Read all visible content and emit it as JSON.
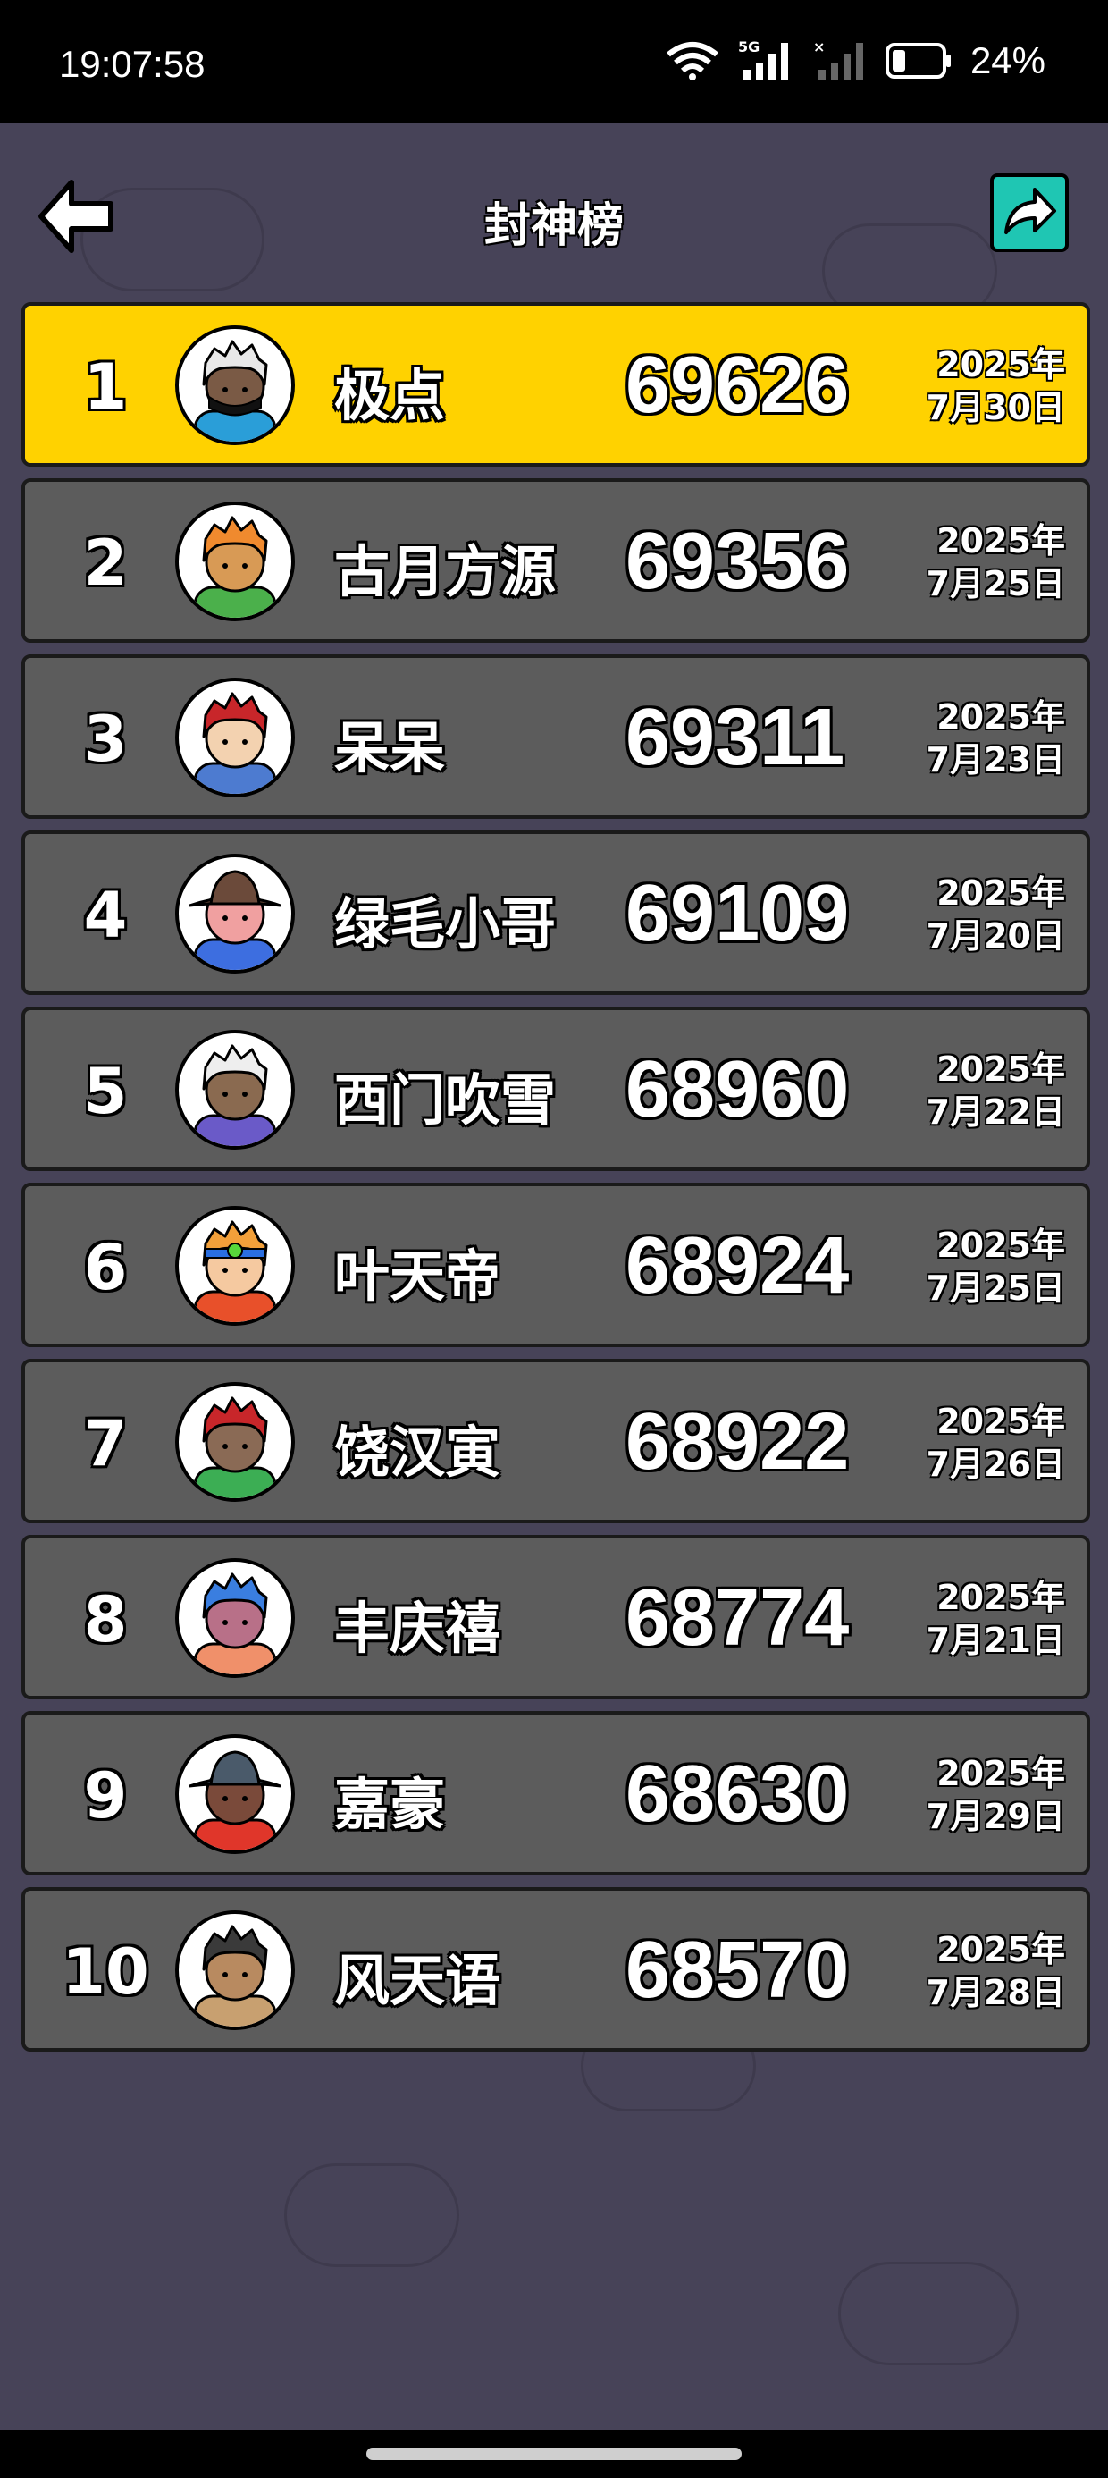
{
  "status_bar": {
    "time": "19:07:58",
    "network_label": "5G",
    "battery": "24%"
  },
  "header": {
    "title": "封神榜",
    "back_icon": "arrow-left-icon",
    "share_icon": "share-icon"
  },
  "colors": {
    "background": "#474358",
    "first_row": "#ffd200",
    "row": "#5c5c5c",
    "share_button": "#1fc6b3"
  },
  "leaderboard": [
    {
      "rank": "1",
      "name": "极点",
      "score": "69626",
      "date_year": "2025年",
      "date_day": "7月30日",
      "avatar": {
        "hair": "#e8e8e8",
        "skin": "#7a5a45",
        "shirt": "#2a9ed8",
        "mask": true
      }
    },
    {
      "rank": "2",
      "name": "古月方源",
      "score": "69356",
      "date_year": "2025年",
      "date_day": "7月25日",
      "avatar": {
        "hair": "#f08a2e",
        "skin": "#d89a55",
        "shirt": "#4bb04b"
      }
    },
    {
      "rank": "3",
      "name": "呆呆",
      "score": "69311",
      "date_year": "2025年",
      "date_day": "7月23日",
      "avatar": {
        "hair": "#c8262a",
        "skin": "#f3d2b0",
        "shirt": "#4d7bd0"
      }
    },
    {
      "rank": "4",
      "name": "绿毛小哥",
      "score": "69109",
      "date_year": "2025年",
      "date_day": "7月20日",
      "avatar": {
        "hair": "#6b4a3a",
        "skin": "#f0a0a0",
        "shirt": "#3d6ee0",
        "hat": true
      }
    },
    {
      "rank": "5",
      "name": "西门吹雪",
      "score": "68960",
      "date_year": "2025年",
      "date_day": "7月22日",
      "avatar": {
        "hair": "#eeeeee",
        "skin": "#8a6a50",
        "shirt": "#6a5ac8"
      }
    },
    {
      "rank": "6",
      "name": "叶天帝",
      "score": "68924",
      "date_year": "2025年",
      "date_day": "7月25日",
      "avatar": {
        "hair": "#f2a03a",
        "skin": "#f5c9a0",
        "shirt": "#e8502a",
        "headband": true
      }
    },
    {
      "rank": "7",
      "name": "饶汉寅",
      "score": "68922",
      "date_year": "2025年",
      "date_day": "7月26日",
      "avatar": {
        "hair": "#c8262a",
        "skin": "#8a6a55",
        "shirt": "#3cae54"
      }
    },
    {
      "rank": "8",
      "name": "丰庆禧",
      "score": "68774",
      "date_year": "2025年",
      "date_day": "7月21日",
      "avatar": {
        "hair": "#3a7ee0",
        "skin": "#b87088",
        "shirt": "#f0906a"
      }
    },
    {
      "rank": "9",
      "name": "嘉豪",
      "score": "68630",
      "date_year": "2025年",
      "date_day": "7月29日",
      "avatar": {
        "hair": "#4a5a6a",
        "skin": "#7a4a3a",
        "shirt": "#e0362a",
        "hat": true
      }
    },
    {
      "rank": "10",
      "name": "风天语",
      "score": "68570",
      "date_year": "2025年",
      "date_day": "7月28日",
      "avatar": {
        "hair": "#3a3a3a",
        "skin": "#b88a60",
        "shirt": "#c8a070"
      }
    }
  ]
}
